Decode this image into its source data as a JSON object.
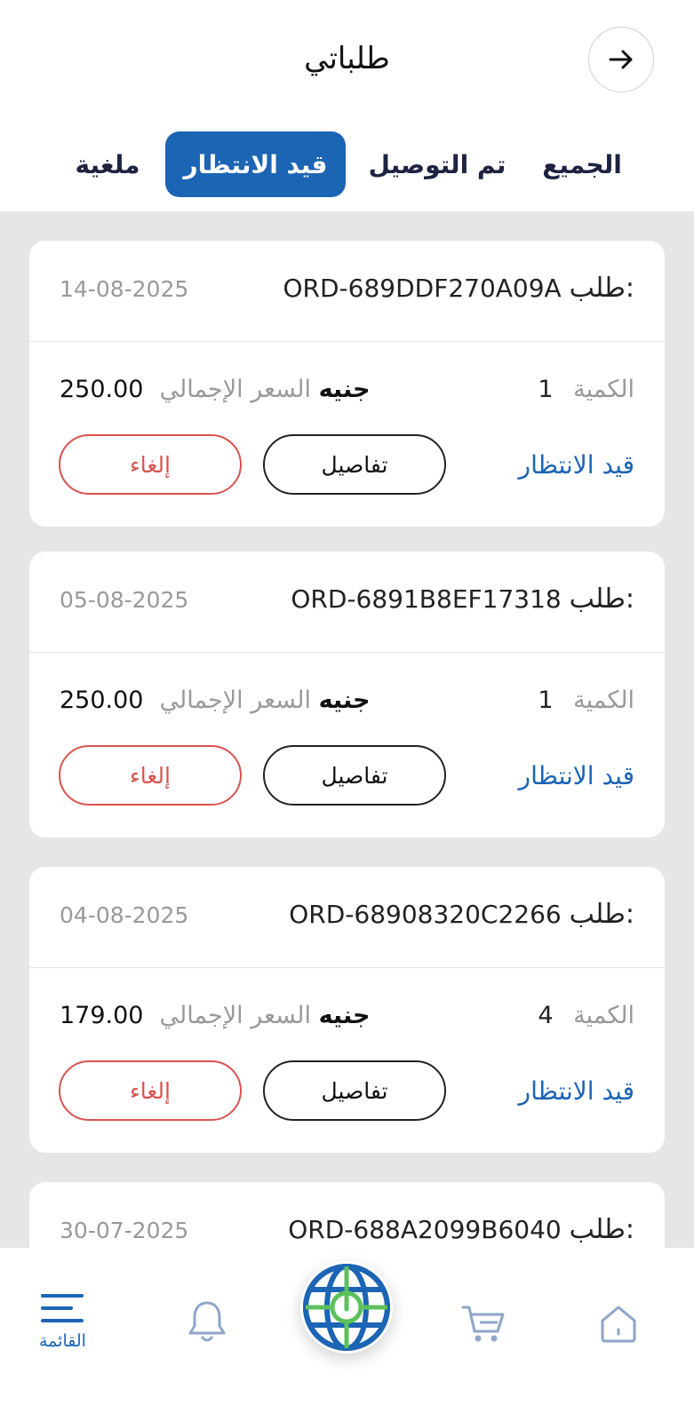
{
  "header": {
    "title": "طلباتي",
    "back_icon": "arrow-right-icon"
  },
  "tabs": [
    {
      "label": "الجميع",
      "active": false
    },
    {
      "label": "تم التوصيل",
      "active": false
    },
    {
      "label": "قيد الانتظار",
      "active": true
    },
    {
      "label": "ملغية",
      "active": false
    }
  ],
  "labels": {
    "order_prefix": "طلب:",
    "quantity": "الكمية",
    "total_price": "السعر الإجمالي",
    "currency": "جنيه",
    "details_button": "تفاصيل",
    "cancel_button": "إلغاء"
  },
  "orders": [
    {
      "id": "ORD-689DDF270A09A",
      "date": "14-08-2025",
      "quantity": "1",
      "total": "250.00",
      "status": "قيد الانتظار"
    },
    {
      "id": "ORD-6891B8EF17318",
      "date": "05-08-2025",
      "quantity": "1",
      "total": "250.00",
      "status": "قيد الانتظار"
    },
    {
      "id": "ORD-68908320C2266",
      "date": "04-08-2025",
      "quantity": "4",
      "total": "179.00",
      "status": "قيد الانتظار"
    },
    {
      "id": "ORD-688A2099B6040",
      "date": "30-07-2025"
    }
  ],
  "bottom_nav": {
    "menu_label": "القائمة",
    "items": [
      "home-icon",
      "cart-icon",
      "globe-power-icon",
      "bell-icon",
      "menu-icon"
    ]
  },
  "colors": {
    "primary": "#1c64b4",
    "cancel": "#d9534f",
    "background_list": "#e6e6e6"
  }
}
